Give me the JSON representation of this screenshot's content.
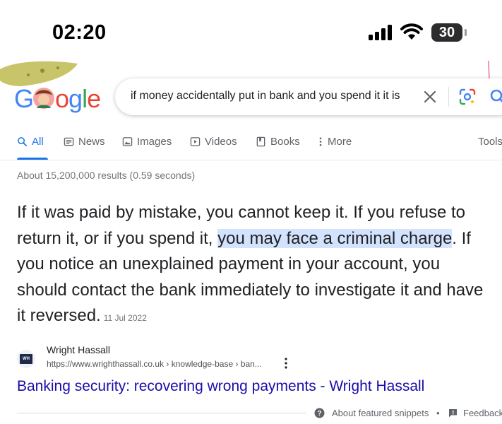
{
  "status_bar": {
    "time": "02:20",
    "battery": "30"
  },
  "logo": {
    "letters": [
      {
        "ch": "G",
        "color": "#4285F4"
      },
      {
        "ch": "",
        "color": "#EA4335"
      },
      {
        "ch": "o",
        "color": "#EA4335"
      },
      {
        "ch": "g",
        "color": "#4285F4"
      },
      {
        "ch": "l",
        "color": "#34A853"
      },
      {
        "ch": "e",
        "color": "#EA4335"
      }
    ]
  },
  "search": {
    "query": "if money accidentally put in bank and you spend it it is"
  },
  "tabs": [
    {
      "label": "All",
      "icon": "search-icon",
      "active": true
    },
    {
      "label": "News",
      "icon": "news-icon"
    },
    {
      "label": "Images",
      "icon": "image-icon"
    },
    {
      "label": "Videos",
      "icon": "video-icon"
    },
    {
      "label": "Books",
      "icon": "book-icon"
    },
    {
      "label": "More",
      "icon": "more-vert-icon"
    },
    {
      "label": "Tools"
    }
  ],
  "result_stats": "About 15,200,000 results (0.59 seconds)",
  "snippet": {
    "before": "If it was paid by mistake, you cannot keep it. If you refuse to return it, or if you spend it, ",
    "highlight": "you may face a criminal charge",
    "after": ". If you notice an unexplained payment in your account, you should contact the bank immediately to investigate it and have it reversed.",
    "date": "11 Jul 2022"
  },
  "source": {
    "favicon_text": "WH",
    "name": "Wright Hassall",
    "url": "https://www.wrighthassall.co.uk › knowledge-base › ban...",
    "title": "Banking security: recovering wrong payments - Wright Hassall"
  },
  "footer": {
    "about": "About featured snippets",
    "separator": "•",
    "feedback": "Feedback"
  },
  "colors": {
    "accent": "#1a73e8",
    "link": "#1a0dab",
    "highlight": "#d3e3fd"
  }
}
